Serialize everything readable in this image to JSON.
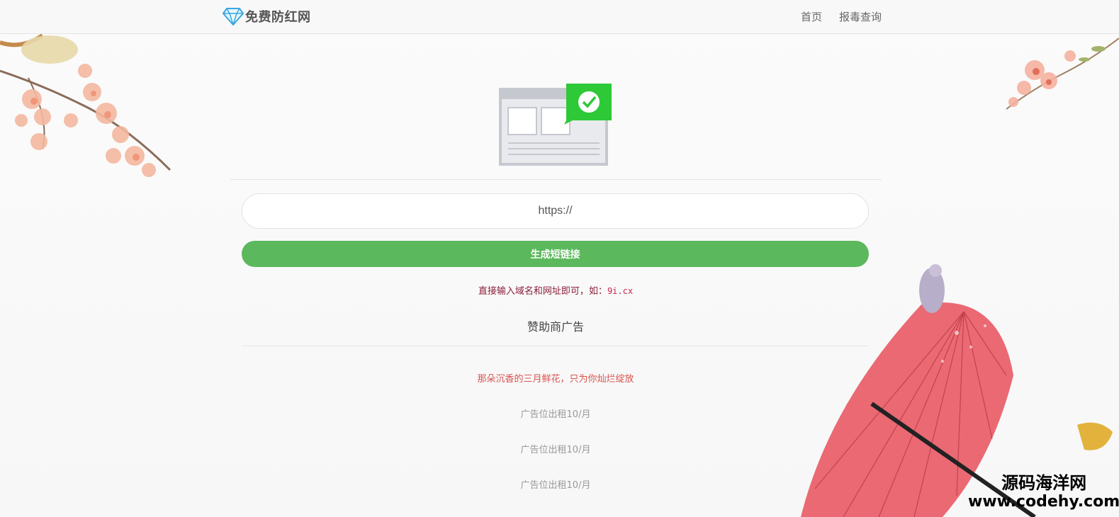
{
  "header": {
    "brand": "免费防红网",
    "nav": [
      "首页",
      "报毒查询"
    ]
  },
  "form": {
    "url_value": "https://",
    "submit_label": "生成短链接",
    "hint_prefix": "直接输入域名和网址即可，如：",
    "hint_example": "9i.cx"
  },
  "ads": {
    "title": "赞助商广告",
    "items": [
      "那朵沉香的三月鲜花，只为你灿烂绽放",
      "广告位出租10/月",
      "广告位出租10/月",
      "广告位出租10/月"
    ]
  },
  "watermark": {
    "cn": "源码海洋网",
    "en": "www.codehy.com"
  },
  "colors": {
    "accent_green": "#5cb85c",
    "check_green": "#2dc937",
    "hint_red": "#c7254e",
    "featured_red": "#d9534f",
    "diamond_blue": "#3aa7e0"
  },
  "icons": {
    "brand": "diamond-icon",
    "hero": "browser-check-illustration"
  }
}
